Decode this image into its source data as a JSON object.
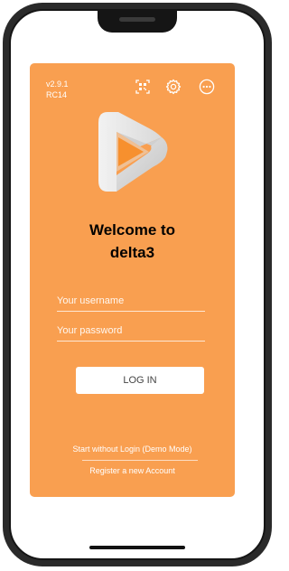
{
  "app": {
    "version": "v2.9.1",
    "build": "RC14",
    "welcome_line1": "Welcome to",
    "welcome_line2": "delta3"
  },
  "toolbar": {
    "icons": [
      "qr-code-icon",
      "gear-icon",
      "more-options-icon"
    ]
  },
  "login": {
    "username_placeholder": "Your username",
    "username_value": "",
    "password_placeholder": "Your password",
    "password_value": "",
    "login_label": "LOG IN"
  },
  "links": {
    "demo_mode": "Start without Login (Demo Mode)",
    "register": "Register a new Account"
  },
  "colors": {
    "card_background": "#F99F50",
    "text_on_card": "#FFFFFF"
  }
}
